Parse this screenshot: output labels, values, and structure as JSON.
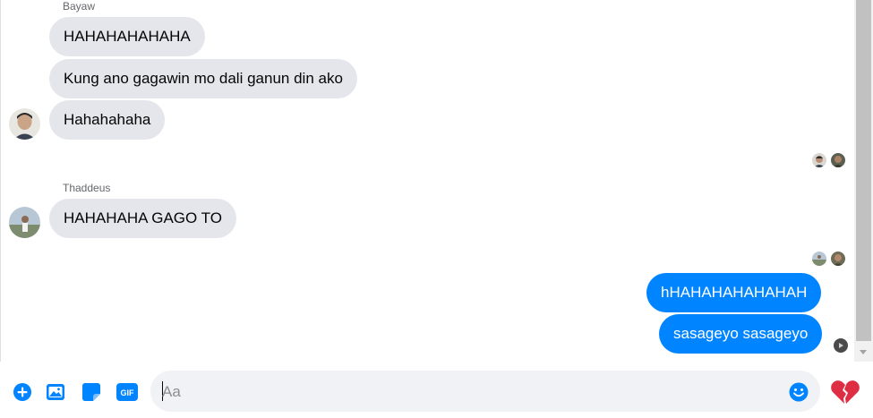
{
  "colors": {
    "accent": "#0084ff",
    "incoming_bubble": "#e4e6eb",
    "outgoing_bubble": "#0084ff",
    "heart": "#e0245e"
  },
  "messages": {
    "group1": {
      "sender": "Bayaw",
      "lines": [
        "HAHAHAHAHAHA",
        "Kung ano gagawin mo dali ganun din ako",
        "Hahahahaha"
      ]
    },
    "group2": {
      "sender": "Thaddeus",
      "lines": [
        "HAHAHAHA GAGO TO"
      ]
    },
    "outgoing": {
      "lines": [
        "hHAHAHAHAHAHAH",
        "sasageyo sasageyo"
      ]
    }
  },
  "composer": {
    "placeholder": "Aa",
    "icons": [
      "add-icon",
      "image-icon",
      "sticker-icon",
      "gif-icon",
      "emoji-icon",
      "broken-heart-icon"
    ],
    "gif_label": "GIF"
  }
}
